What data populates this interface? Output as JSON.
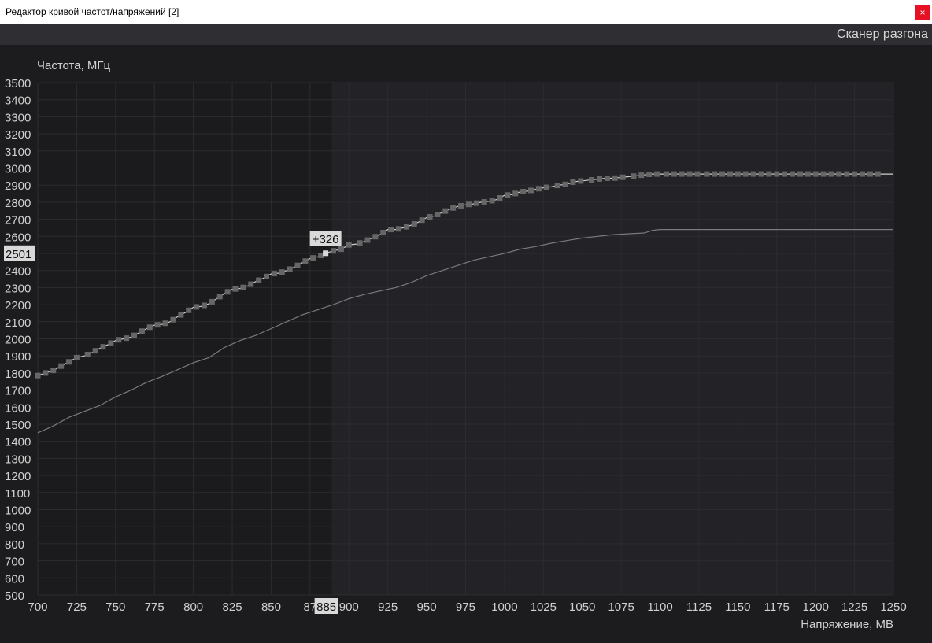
{
  "window": {
    "title": "Редактор кривой частот/напряжений [2]",
    "close_label": "×"
  },
  "toolbar": {
    "scanner_label": "Сканер разгона"
  },
  "chart_data": {
    "type": "line",
    "title": "",
    "ylabel": "Частота, МГц",
    "xlabel": "Напряжение, МВ",
    "xlim": [
      700,
      1250
    ],
    "ylim": [
      500,
      3500
    ],
    "x_ticks": [
      700,
      725,
      750,
      775,
      800,
      825,
      850,
      875,
      900,
      925,
      950,
      975,
      1000,
      1025,
      1050,
      1075,
      1100,
      1125,
      1150,
      1175,
      1200,
      1225,
      1250
    ],
    "x_tick_labels": [
      "700",
      "725",
      "750",
      "775",
      "800",
      "825",
      "850",
      "87",
      "900",
      "925",
      "950",
      "975",
      "1000",
      "1025",
      "1050",
      "1075",
      "1100",
      "1125",
      "1150",
      "1175",
      "1200",
      "1225",
      "1250"
    ],
    "y_ticks": [
      500,
      600,
      700,
      800,
      900,
      1000,
      1100,
      1200,
      1300,
      1400,
      1500,
      1600,
      1700,
      1800,
      1900,
      2000,
      2100,
      2200,
      2300,
      2400,
      2500,
      2600,
      2700,
      2800,
      2900,
      3000,
      3100,
      3200,
      3300,
      3400,
      3500
    ],
    "grid": true,
    "selected_point": {
      "x": 885,
      "y": 2501,
      "offset_label": "+326",
      "x_label": "885",
      "y_label": "2501"
    },
    "series": [
      {
        "role": "curve",
        "markers": true,
        "x": [
          700,
          705,
          710,
          715,
          720,
          725,
          730,
          735,
          740,
          745,
          750,
          755,
          760,
          765,
          770,
          775,
          780,
          785,
          790,
          795,
          800,
          805,
          810,
          815,
          820,
          825,
          830,
          835,
          840,
          845,
          850,
          855,
          860,
          865,
          870,
          875,
          880,
          885,
          890,
          895,
          900,
          905,
          910,
          915,
          920,
          925,
          930,
          935,
          940,
          945,
          950,
          955,
          960,
          965,
          970,
          975,
          980,
          985,
          990,
          995,
          1000,
          1005,
          1010,
          1015,
          1020,
          1025,
          1030,
          1035,
          1040,
          1045,
          1050,
          1055,
          1060,
          1065,
          1070,
          1075,
          1080,
          1085,
          1090,
          1095,
          1100,
          1105,
          1110,
          1115,
          1120,
          1125,
          1130,
          1135,
          1140,
          1145,
          1150,
          1155,
          1160,
          1165,
          1170,
          1175,
          1180,
          1185,
          1190,
          1195,
          1200,
          1205,
          1210,
          1215,
          1220,
          1225,
          1230,
          1235,
          1240,
          1245,
          1250
        ],
        "y": [
          1785,
          1800,
          1815,
          1840,
          1865,
          1890,
          1900,
          1920,
          1945,
          1965,
          1990,
          2000,
          2010,
          2035,
          2060,
          2080,
          2085,
          2100,
          2130,
          2155,
          2185,
          2190,
          2205,
          2235,
          2265,
          2290,
          2295,
          2310,
          2335,
          2355,
          2380,
          2385,
          2400,
          2420,
          2445,
          2470,
          2480,
          2501,
          2515,
          2525,
          2550,
          2555,
          2570,
          2590,
          2610,
          2640,
          2640,
          2650,
          2665,
          2685,
          2710,
          2720,
          2740,
          2760,
          2775,
          2785,
          2790,
          2800,
          2805,
          2815,
          2840,
          2845,
          2860,
          2865,
          2875,
          2885,
          2890,
          2900,
          2905,
          2920,
          2925,
          2930,
          2935,
          2940,
          2940,
          2945,
          2950,
          2955,
          2960,
          2965,
          2965,
          2965,
          2965,
          2965,
          2965,
          2965,
          2965,
          2965,
          2965,
          2965,
          2965,
          2965,
          2965,
          2965,
          2965,
          2965,
          2965,
          2965,
          2965,
          2965,
          2965,
          2965,
          2965,
          2965,
          2965,
          2965,
          2965,
          2965,
          2965,
          2965,
          2965
        ],
        "marker_x": [
          700,
          705,
          710,
          715,
          720,
          725,
          732,
          737,
          742,
          747,
          752,
          757,
          762,
          767,
          772,
          777,
          782,
          787,
          792,
          797,
          802,
          807,
          812,
          817,
          822,
          827,
          832,
          837,
          842,
          847,
          852,
          857,
          862,
          867,
          872,
          877,
          882,
          885,
          890,
          895,
          900,
          907,
          912,
          917,
          922,
          927,
          932,
          937,
          942,
          947,
          952,
          957,
          962,
          967,
          972,
          977,
          982,
          987,
          992,
          997,
          1002,
          1007,
          1012,
          1017,
          1022,
          1027,
          1034,
          1039,
          1044,
          1049,
          1056,
          1061,
          1066,
          1071,
          1076,
          1083,
          1088,
          1093,
          1098,
          1104,
          1109,
          1114,
          1119,
          1124,
          1130,
          1135,
          1140,
          1145,
          1150,
          1155,
          1160,
          1165,
          1170,
          1175,
          1180,
          1185,
          1190,
          1195,
          1200,
          1205,
          1210,
          1215,
          1220,
          1225,
          1230,
          1235,
          1240
        ]
      },
      {
        "role": "baseline",
        "markers": false,
        "x": [
          700,
          710,
          720,
          730,
          740,
          750,
          760,
          770,
          780,
          790,
          800,
          810,
          820,
          830,
          840,
          850,
          860,
          870,
          880,
          890,
          900,
          910,
          920,
          930,
          940,
          950,
          960,
          970,
          980,
          990,
          1000,
          1010,
          1020,
          1030,
          1040,
          1050,
          1060,
          1070,
          1080,
          1090,
          1095,
          1100,
          1110,
          1125,
          1150,
          1175,
          1200,
          1225,
          1250
        ],
        "y": [
          1450,
          1490,
          1540,
          1575,
          1610,
          1660,
          1700,
          1745,
          1780,
          1820,
          1860,
          1890,
          1950,
          1990,
          2020,
          2060,
          2100,
          2140,
          2170,
          2200,
          2235,
          2260,
          2280,
          2300,
          2330,
          2370,
          2400,
          2430,
          2460,
          2480,
          2500,
          2525,
          2540,
          2560,
          2575,
          2590,
          2600,
          2610,
          2615,
          2620,
          2635,
          2640,
          2640,
          2640,
          2640,
          2640,
          2640,
          2640,
          2640
        ]
      }
    ],
    "colors": {
      "curve": "#cfcfcf",
      "marker": "#666666",
      "selected_marker": "#d9d9d9",
      "baseline": "#7a7a7a",
      "grid": "#2c2c30",
      "plot_bg_left": "#1b1b1d",
      "plot_bg_right": "#232327",
      "label_box": "#d9d9d9"
    }
  }
}
